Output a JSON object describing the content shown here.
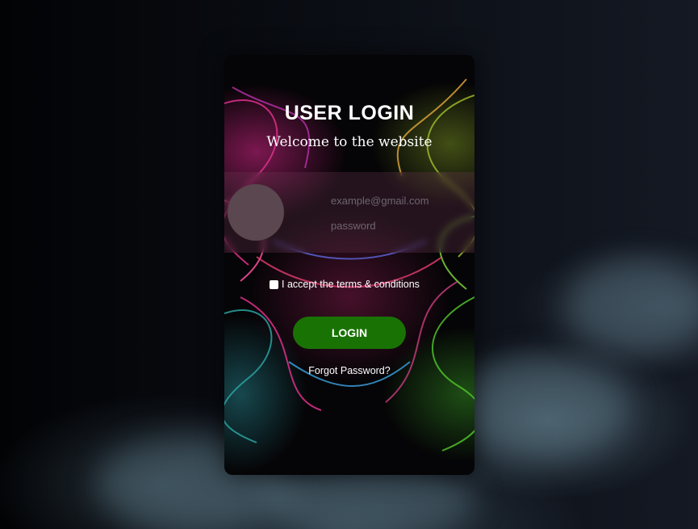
{
  "login": {
    "title": "USER LOGIN",
    "subtitle": "Welcome to the website",
    "email_placeholder": "example@gmail.com",
    "password_placeholder": "password",
    "terms_label": "I accept the terms & conditions",
    "login_button": "LOGIN",
    "forgot_link": "Forgot Password?"
  },
  "colors": {
    "login_button": "#197304",
    "avatar": "#5a474f",
    "page_background": "#05070b"
  },
  "icons": {
    "avatar": "user-avatar-placeholder"
  }
}
